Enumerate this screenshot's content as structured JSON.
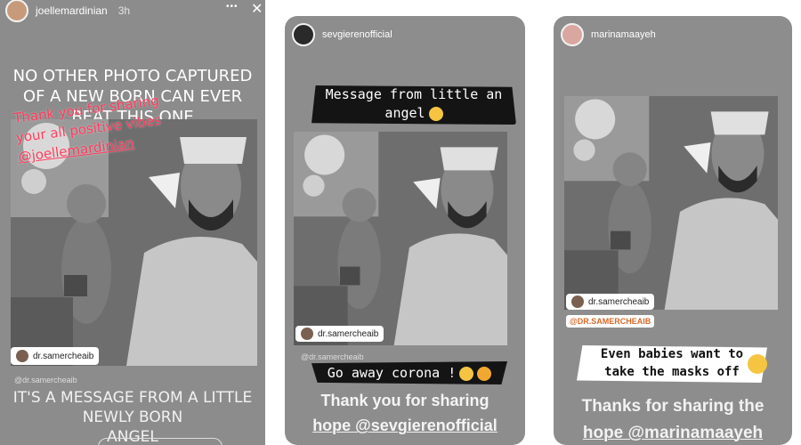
{
  "story1": {
    "username": "joellemardinian",
    "time": "3h",
    "more_label": "•••",
    "close_label": "✕",
    "caption_top": "NO OTHER PHOTO CAPTURED OF A NEW BORN CAN EVER BEAT THIS ONE",
    "overlay_lines": [
      "Thank you for sharing",
      "your all positive vibes",
      "@joellemardinian"
    ],
    "tag_label": "dr.samercheaib",
    "mention": "@dr.samercheaib",
    "bottom_lines": [
      "IT'S A MESSAGE FROM A LITTLE",
      "NEWLY BORN",
      "ANGEL"
    ]
  },
  "story2": {
    "username": "sevgierenofficial",
    "sticker_lines": [
      "Message from little an",
      "angel"
    ],
    "tag_label": "dr.samercheaib",
    "mention": "@dr.samercheaib",
    "go_away": "Go away corona !",
    "bottom_lines": [
      "Thank you for sharing",
      "hope @sevgierenofficial"
    ]
  },
  "story3": {
    "username": "marinamaayeh",
    "tag_label": "dr.samercheaib",
    "mention": "@DR.SAMERCHEAIB",
    "sticker_lines": [
      "Even babies want to",
      "take the masks off"
    ],
    "bottom_lines": [
      "Thanks for sharing the",
      "hope @marinamaayeh"
    ]
  },
  "colors": {
    "overlay_pink": "#ff3b5c",
    "brush_black": "#141414",
    "story_grey": "#8d8d8d"
  }
}
